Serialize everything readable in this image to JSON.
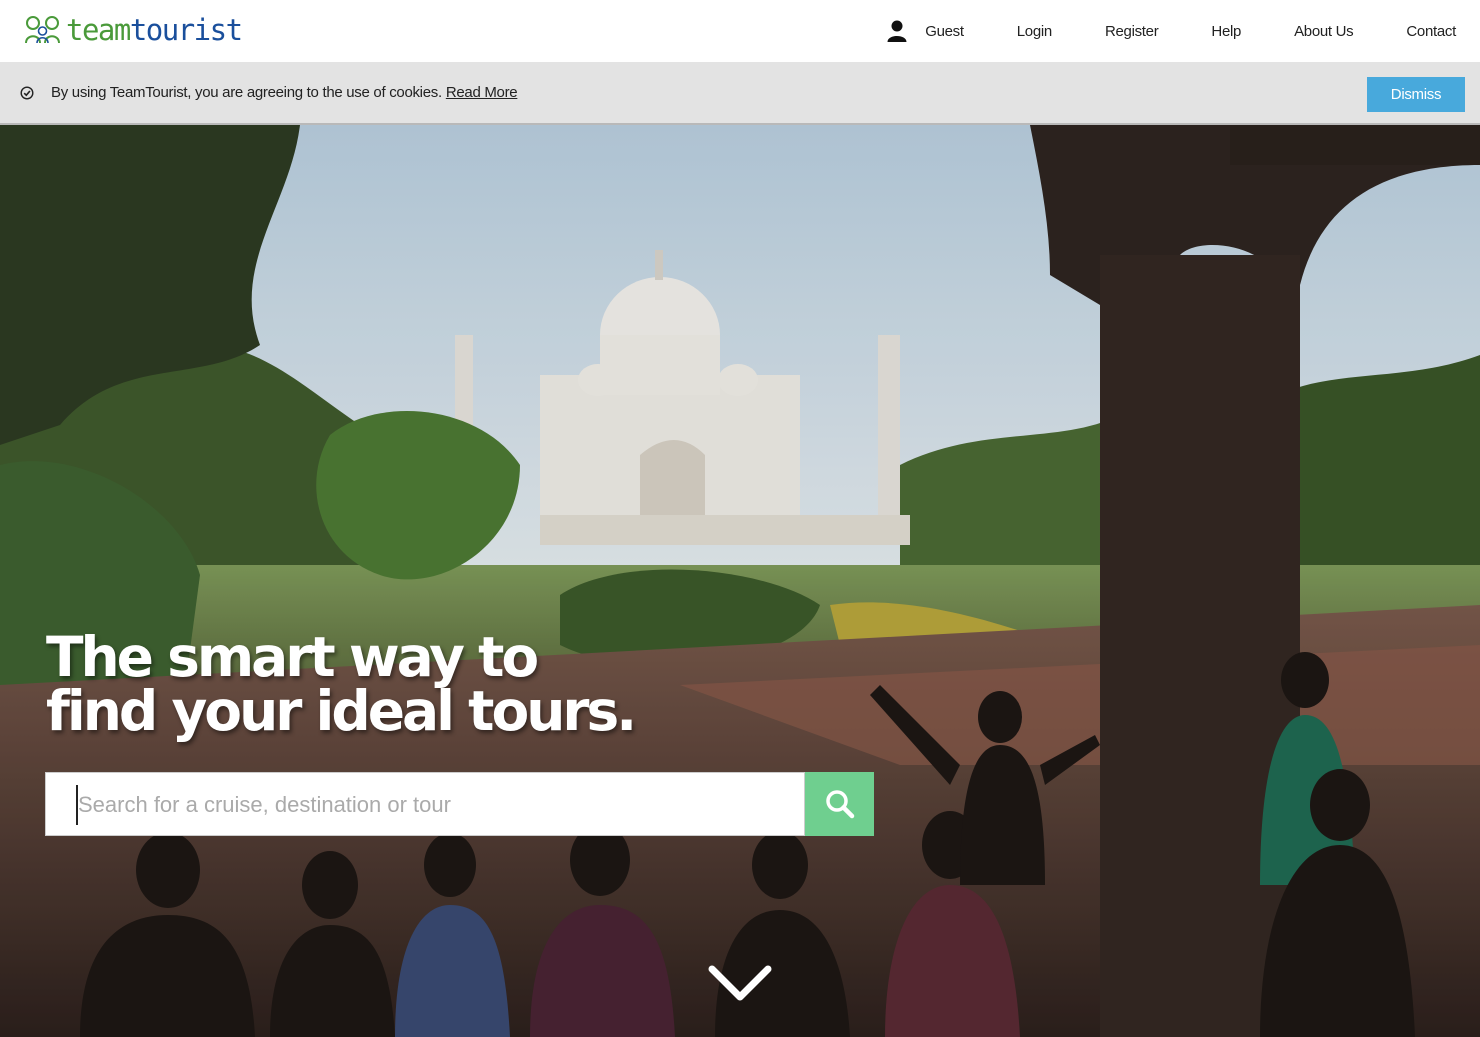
{
  "header": {
    "logo": {
      "team": "team",
      "tourist": "tourist"
    },
    "nav": [
      {
        "id": "guest",
        "label": "Guest"
      },
      {
        "id": "login",
        "label": "Login"
      },
      {
        "id": "register",
        "label": "Register"
      },
      {
        "id": "help",
        "label": "Help"
      },
      {
        "id": "about",
        "label": "About Us"
      },
      {
        "id": "contact",
        "label": "Contact"
      }
    ]
  },
  "cookie_bar": {
    "message": "By using TeamTourist, you are agreeing to the use of cookies.",
    "link_label": "Read More",
    "dismiss_label": "Dismiss"
  },
  "hero": {
    "headline_line1": "The smart way to",
    "headline_line2": "find your ideal tours.",
    "search": {
      "placeholder": "Search for a cruise, destination or tour",
      "value": ""
    }
  },
  "colors": {
    "logo_green": "#4a9a3a",
    "logo_blue": "#1a4f9c",
    "dismiss_blue": "#48a9dc",
    "search_green": "#6fcf8f",
    "cookie_bg": "#e3e3e3"
  },
  "icons": {
    "user": "user-icon",
    "check": "check-circle-icon",
    "search": "search-icon",
    "scroll": "chevron-down-icon"
  }
}
